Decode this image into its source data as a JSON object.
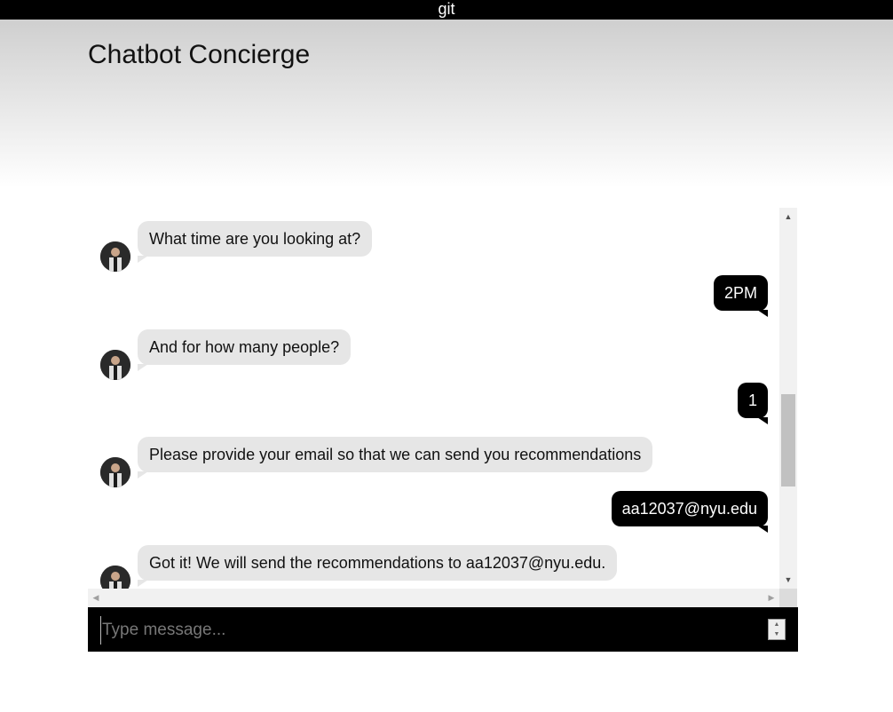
{
  "topbar": {
    "label": "git"
  },
  "header": {
    "title": "Chatbot Concierge"
  },
  "messages": [
    {
      "from": "bot",
      "text": "What time are you looking at?"
    },
    {
      "from": "user",
      "text": "2PM"
    },
    {
      "from": "bot",
      "text": "And for how many people?"
    },
    {
      "from": "user",
      "text": "1"
    },
    {
      "from": "bot",
      "text": "Please provide your email so that we can send you recommendations"
    },
    {
      "from": "user",
      "text": "aa12037@nyu.edu"
    },
    {
      "from": "bot",
      "text": "Got it! We will send the recommendations to aa12037@nyu.edu."
    }
  ],
  "composer": {
    "placeholder": "Type message..."
  },
  "colors": {
    "user_bubble": "#000000",
    "bot_bubble": "#e6e6e6",
    "input_bar": "#000000"
  },
  "icons": {
    "scroll_up": "triangle-up",
    "scroll_down": "triangle-down",
    "scroll_left": "triangle-left",
    "scroll_right": "triangle-right",
    "avatar": "user-photo"
  }
}
